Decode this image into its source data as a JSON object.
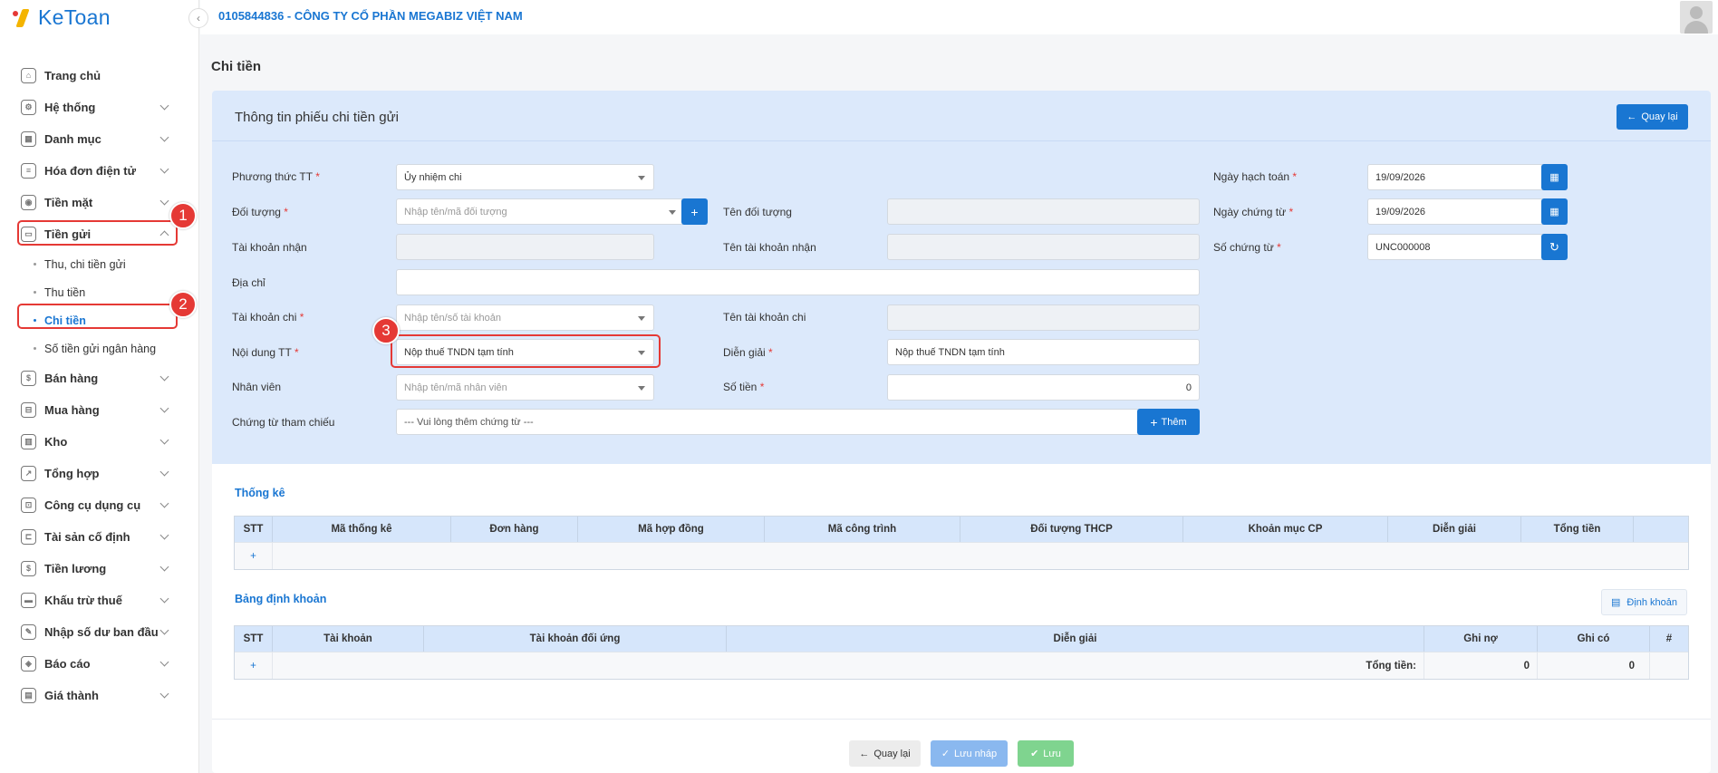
{
  "app": {
    "logo": "KeToan",
    "company": "0105844836 - CÔNG TY CỔ PHẦN MEGABIZ VIỆT NAM"
  },
  "sidebar": {
    "items": [
      {
        "label": "Trang chủ",
        "icon": "home-icon"
      },
      {
        "label": "Hệ thống",
        "icon": "gear-icon"
      },
      {
        "label": "Danh mục",
        "icon": "grid-icon"
      },
      {
        "label": "Hóa đơn điện tử",
        "icon": "invoice-icon"
      },
      {
        "label": "Tiền mặt",
        "icon": "cash-icon"
      },
      {
        "label": "Tiền gửi",
        "icon": "card-icon"
      }
    ],
    "sub_items": [
      {
        "label": "Thu, chi tiền gửi"
      },
      {
        "label": "Thu tiền"
      },
      {
        "label": "Chi tiền"
      },
      {
        "label": "Số tiền gửi ngân hàng"
      }
    ],
    "items2": [
      {
        "label": "Bán hàng",
        "icon": "bag-icon"
      },
      {
        "label": "Mua hàng",
        "icon": "cart-icon"
      },
      {
        "label": "Kho",
        "icon": "warehouse-icon"
      },
      {
        "label": "Tổng hợp",
        "icon": "chart-icon"
      },
      {
        "label": "Công cụ dụng cụ",
        "icon": "tool-icon"
      },
      {
        "label": "Tài sản cố định",
        "icon": "car-icon"
      },
      {
        "label": "Tiền lương",
        "icon": "money-icon"
      },
      {
        "label": "Khấu trừ thuế",
        "icon": "tax-icon"
      },
      {
        "label": "Nhập số dư ban đầu",
        "icon": "edit-icon"
      },
      {
        "label": "Báo cáo",
        "icon": "report-icon"
      },
      {
        "label": "Giá thành",
        "icon": "price-icon"
      }
    ]
  },
  "annotations": {
    "a1": "1",
    "a2": "2",
    "a3": "3"
  },
  "page": {
    "title": "Chi tiền"
  },
  "form": {
    "title": "Thông tin phiếu chi tiền gửi",
    "back_label": "Quay lại",
    "phuong_thuc_label": "Phương thức TT",
    "phuong_thuc_value": "Ủy nhiệm chi",
    "doi_tuong_label": "Đối tượng",
    "doi_tuong_placeholder": "Nhập tên/mã đối tượng",
    "ten_doi_tuong_label": "Tên đối tượng",
    "tk_nhan_label": "Tài khoản nhận",
    "ten_tk_nhan_label": "Tên tài khoản nhận",
    "dia_chi_label": "Địa chỉ",
    "tk_chi_label": "Tài khoản chi",
    "tk_chi_placeholder": "Nhập tên/số tài khoản",
    "ten_tk_chi_label": "Tên tài khoản chi",
    "noi_dung_label": "Nội dung TT",
    "noi_dung_value": "Nộp thuế TNDN tạm tính",
    "dien_giai_label": "Diễn giải",
    "dien_giai_value": "Nộp thuế TNDN tạm tính",
    "nhan_vien_label": "Nhân viên",
    "nhan_vien_placeholder": "Nhập tên/mã nhân viên",
    "so_tien_label": "Số tiền",
    "so_tien_value": "0",
    "chung_tu_label": "Chứng từ tham chiếu",
    "chung_tu_placeholder": "--- Vui lòng thêm chứng từ ---",
    "them_label": "Thêm",
    "ngay_hach_toan_label": "Ngày hạch toán",
    "ngay_hach_toan_value": "19/09/2026",
    "ngay_chung_tu_label": "Ngày chứng từ",
    "ngay_chung_tu_value": "19/09/2026",
    "so_chung_tu_label": "Số chứng từ",
    "so_chung_tu_value": "UNC000008",
    "required_mark": "*"
  },
  "thong_ke": {
    "title": "Thống kê",
    "columns": [
      "STT",
      "Mã thống kê",
      "Đơn hàng",
      "Mã hợp đồng",
      "Mã công trình",
      "Đối tượng THCP",
      "Khoản mục CP",
      "Diễn giải",
      "Tổng tiền"
    ],
    "add": "+"
  },
  "dinh_khoan": {
    "title": "Bảng định khoản",
    "button": "Định khoản",
    "columns": [
      "STT",
      "Tài khoản",
      "Tài khoản đối ứng",
      "Diễn giải",
      "Ghi nợ",
      "Ghi có",
      "#"
    ],
    "add": "+",
    "total_label": "Tổng tiền:",
    "total_no": "0",
    "total_co": "0"
  },
  "footer": {
    "back": "Quay lại",
    "draft": "Lưu nháp",
    "save": "Lưu"
  }
}
